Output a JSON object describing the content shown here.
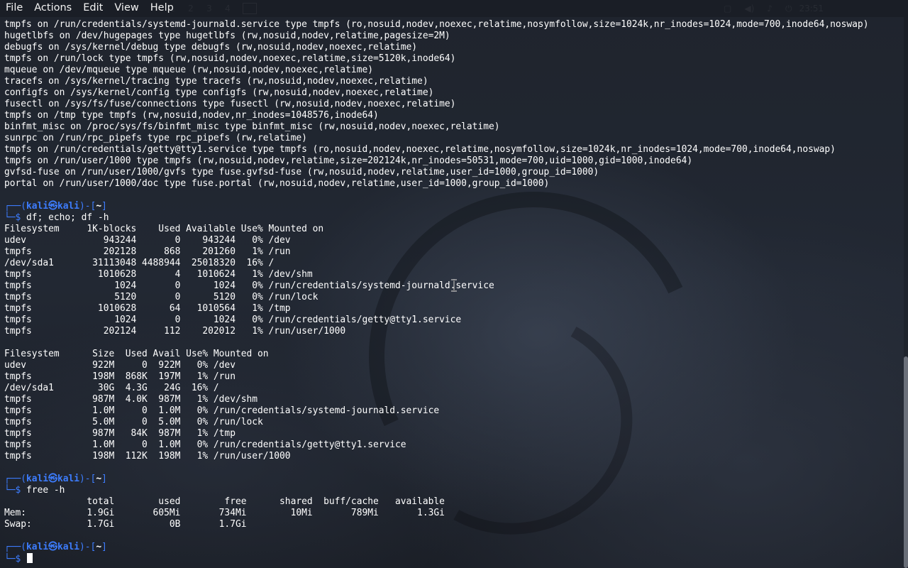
{
  "menu": [
    "File",
    "Actions",
    "Edit",
    "View",
    "Help"
  ],
  "panel": {
    "workspaces": [
      "1",
      "2",
      "3",
      "4"
    ],
    "clock": "23:51"
  },
  "terminal": {
    "lines": [
      {
        "t": "out",
        "text": "tmpfs on /run/credentials/systemd-journald.service type tmpfs (ro,nosuid,nodev,noexec,relatime,nosymfollow,size=1024k,nr_inodes=1024,mode=700,inode64,noswap)"
      },
      {
        "t": "out",
        "text": "hugetlbfs on /dev/hugepages type hugetlbfs (rw,nosuid,nodev,relatime,pagesize=2M)"
      },
      {
        "t": "out",
        "text": "debugfs on /sys/kernel/debug type debugfs (rw,nosuid,nodev,noexec,relatime)"
      },
      {
        "t": "out",
        "text": "tmpfs on /run/lock type tmpfs (rw,nosuid,nodev,noexec,relatime,size=5120k,inode64)"
      },
      {
        "t": "out",
        "text": "mqueue on /dev/mqueue type mqueue (rw,nosuid,nodev,noexec,relatime)"
      },
      {
        "t": "out",
        "text": "tracefs on /sys/kernel/tracing type tracefs (rw,nosuid,nodev,noexec,relatime)"
      },
      {
        "t": "out",
        "text": "configfs on /sys/kernel/config type configfs (rw,nosuid,nodev,noexec,relatime)"
      },
      {
        "t": "out",
        "text": "fusectl on /sys/fs/fuse/connections type fusectl (rw,nosuid,nodev,noexec,relatime)"
      },
      {
        "t": "out",
        "text": "tmpfs on /tmp type tmpfs (rw,nosuid,nodev,nr_inodes=1048576,inode64)"
      },
      {
        "t": "out",
        "text": "binfmt_misc on /proc/sys/fs/binfmt_misc type binfmt_misc (rw,nosuid,nodev,noexec,relatime)"
      },
      {
        "t": "out",
        "text": "sunrpc on /run/rpc_pipefs type rpc_pipefs (rw,relatime)"
      },
      {
        "t": "out",
        "text": "tmpfs on /run/credentials/getty@tty1.service type tmpfs (ro,nosuid,nodev,noexec,relatime,nosymfollow,size=1024k,nr_inodes=1024,mode=700,inode64,noswap)"
      },
      {
        "t": "out",
        "text": "tmpfs on /run/user/1000 type tmpfs (rw,nosuid,nodev,relatime,size=202124k,nr_inodes=50531,mode=700,uid=1000,gid=1000,inode64)"
      },
      {
        "t": "out",
        "text": "gvfsd-fuse on /run/user/1000/gvfs type fuse.gvfsd-fuse (rw,nosuid,nodev,relatime,user_id=1000,group_id=1000)"
      },
      {
        "t": "out",
        "text": "portal on /run/user/1000/doc type fuse.portal (rw,nosuid,nodev,relatime,user_id=1000,group_id=1000)"
      },
      {
        "t": "blank",
        "text": ""
      },
      {
        "t": "prompt1",
        "user": "kali",
        "host": "kali",
        "dir": "~"
      },
      {
        "t": "prompt2",
        "cmd": "df; echo; df -h"
      },
      {
        "t": "out",
        "text": "Filesystem     1K-blocks    Used Available Use% Mounted on"
      },
      {
        "t": "out",
        "text": "udev              943244       0    943244   0% /dev"
      },
      {
        "t": "out",
        "text": "tmpfs             202128     868    201260   1% /run"
      },
      {
        "t": "out",
        "text": "/dev/sda1       31113048 4488944  25018320  16% /"
      },
      {
        "t": "out",
        "text": "tmpfs            1010628       4   1010624   1% /dev/shm"
      },
      {
        "t": "out",
        "text": "tmpfs               1024       0      1024   0% /run/credentials/systemd-journald.service"
      },
      {
        "t": "out",
        "text": "tmpfs               5120       0      5120   0% /run/lock"
      },
      {
        "t": "out",
        "text": "tmpfs            1010628      64   1010564   1% /tmp"
      },
      {
        "t": "out",
        "text": "tmpfs               1024       0      1024   0% /run/credentials/getty@tty1.service"
      },
      {
        "t": "out",
        "text": "tmpfs             202124     112    202012   1% /run/user/1000"
      },
      {
        "t": "blank",
        "text": ""
      },
      {
        "t": "out",
        "text": "Filesystem      Size  Used Avail Use% Mounted on"
      },
      {
        "t": "out",
        "text": "udev            922M     0  922M   0% /dev"
      },
      {
        "t": "out",
        "text": "tmpfs           198M  868K  197M   1% /run"
      },
      {
        "t": "out",
        "text": "/dev/sda1        30G  4.3G   24G  16% /"
      },
      {
        "t": "out",
        "text": "tmpfs           987M  4.0K  987M   1% /dev/shm"
      },
      {
        "t": "out",
        "text": "tmpfs           1.0M     0  1.0M   0% /run/credentials/systemd-journald.service"
      },
      {
        "t": "out",
        "text": "tmpfs           5.0M     0  5.0M   0% /run/lock"
      },
      {
        "t": "out",
        "text": "tmpfs           987M   84K  987M   1% /tmp"
      },
      {
        "t": "out",
        "text": "tmpfs           1.0M     0  1.0M   0% /run/credentials/getty@tty1.service"
      },
      {
        "t": "out",
        "text": "tmpfs           198M  112K  198M   1% /run/user/1000"
      },
      {
        "t": "blank",
        "text": ""
      },
      {
        "t": "prompt1",
        "user": "kali",
        "host": "kali",
        "dir": "~"
      },
      {
        "t": "prompt2",
        "cmd": "free -h"
      },
      {
        "t": "out",
        "text": "               total        used        free      shared  buff/cache   available"
      },
      {
        "t": "out",
        "text": "Mem:           1.9Gi       605Mi       734Mi        10Mi       789Mi       1.3Gi"
      },
      {
        "t": "out",
        "text": "Swap:          1.7Gi          0B       1.7Gi"
      },
      {
        "t": "blank",
        "text": ""
      },
      {
        "t": "prompt1",
        "user": "kali",
        "host": "kali",
        "dir": "~"
      },
      {
        "t": "prompt2",
        "cmd": "",
        "cursor": true
      }
    ]
  },
  "colors": {
    "prompt": "#3d7dff",
    "text": "#ffffff",
    "background": "#1a1e26"
  }
}
